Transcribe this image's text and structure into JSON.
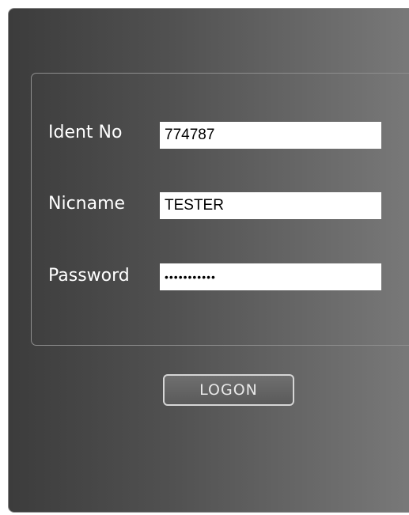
{
  "login_form": {
    "ident_no": {
      "label": "Ident No",
      "value": "774787"
    },
    "nickname": {
      "label": "Nicname",
      "value": "TESTER"
    },
    "password": {
      "label": "Password",
      "value": "•••••••••••"
    },
    "logon_button_label": "LOGON"
  }
}
